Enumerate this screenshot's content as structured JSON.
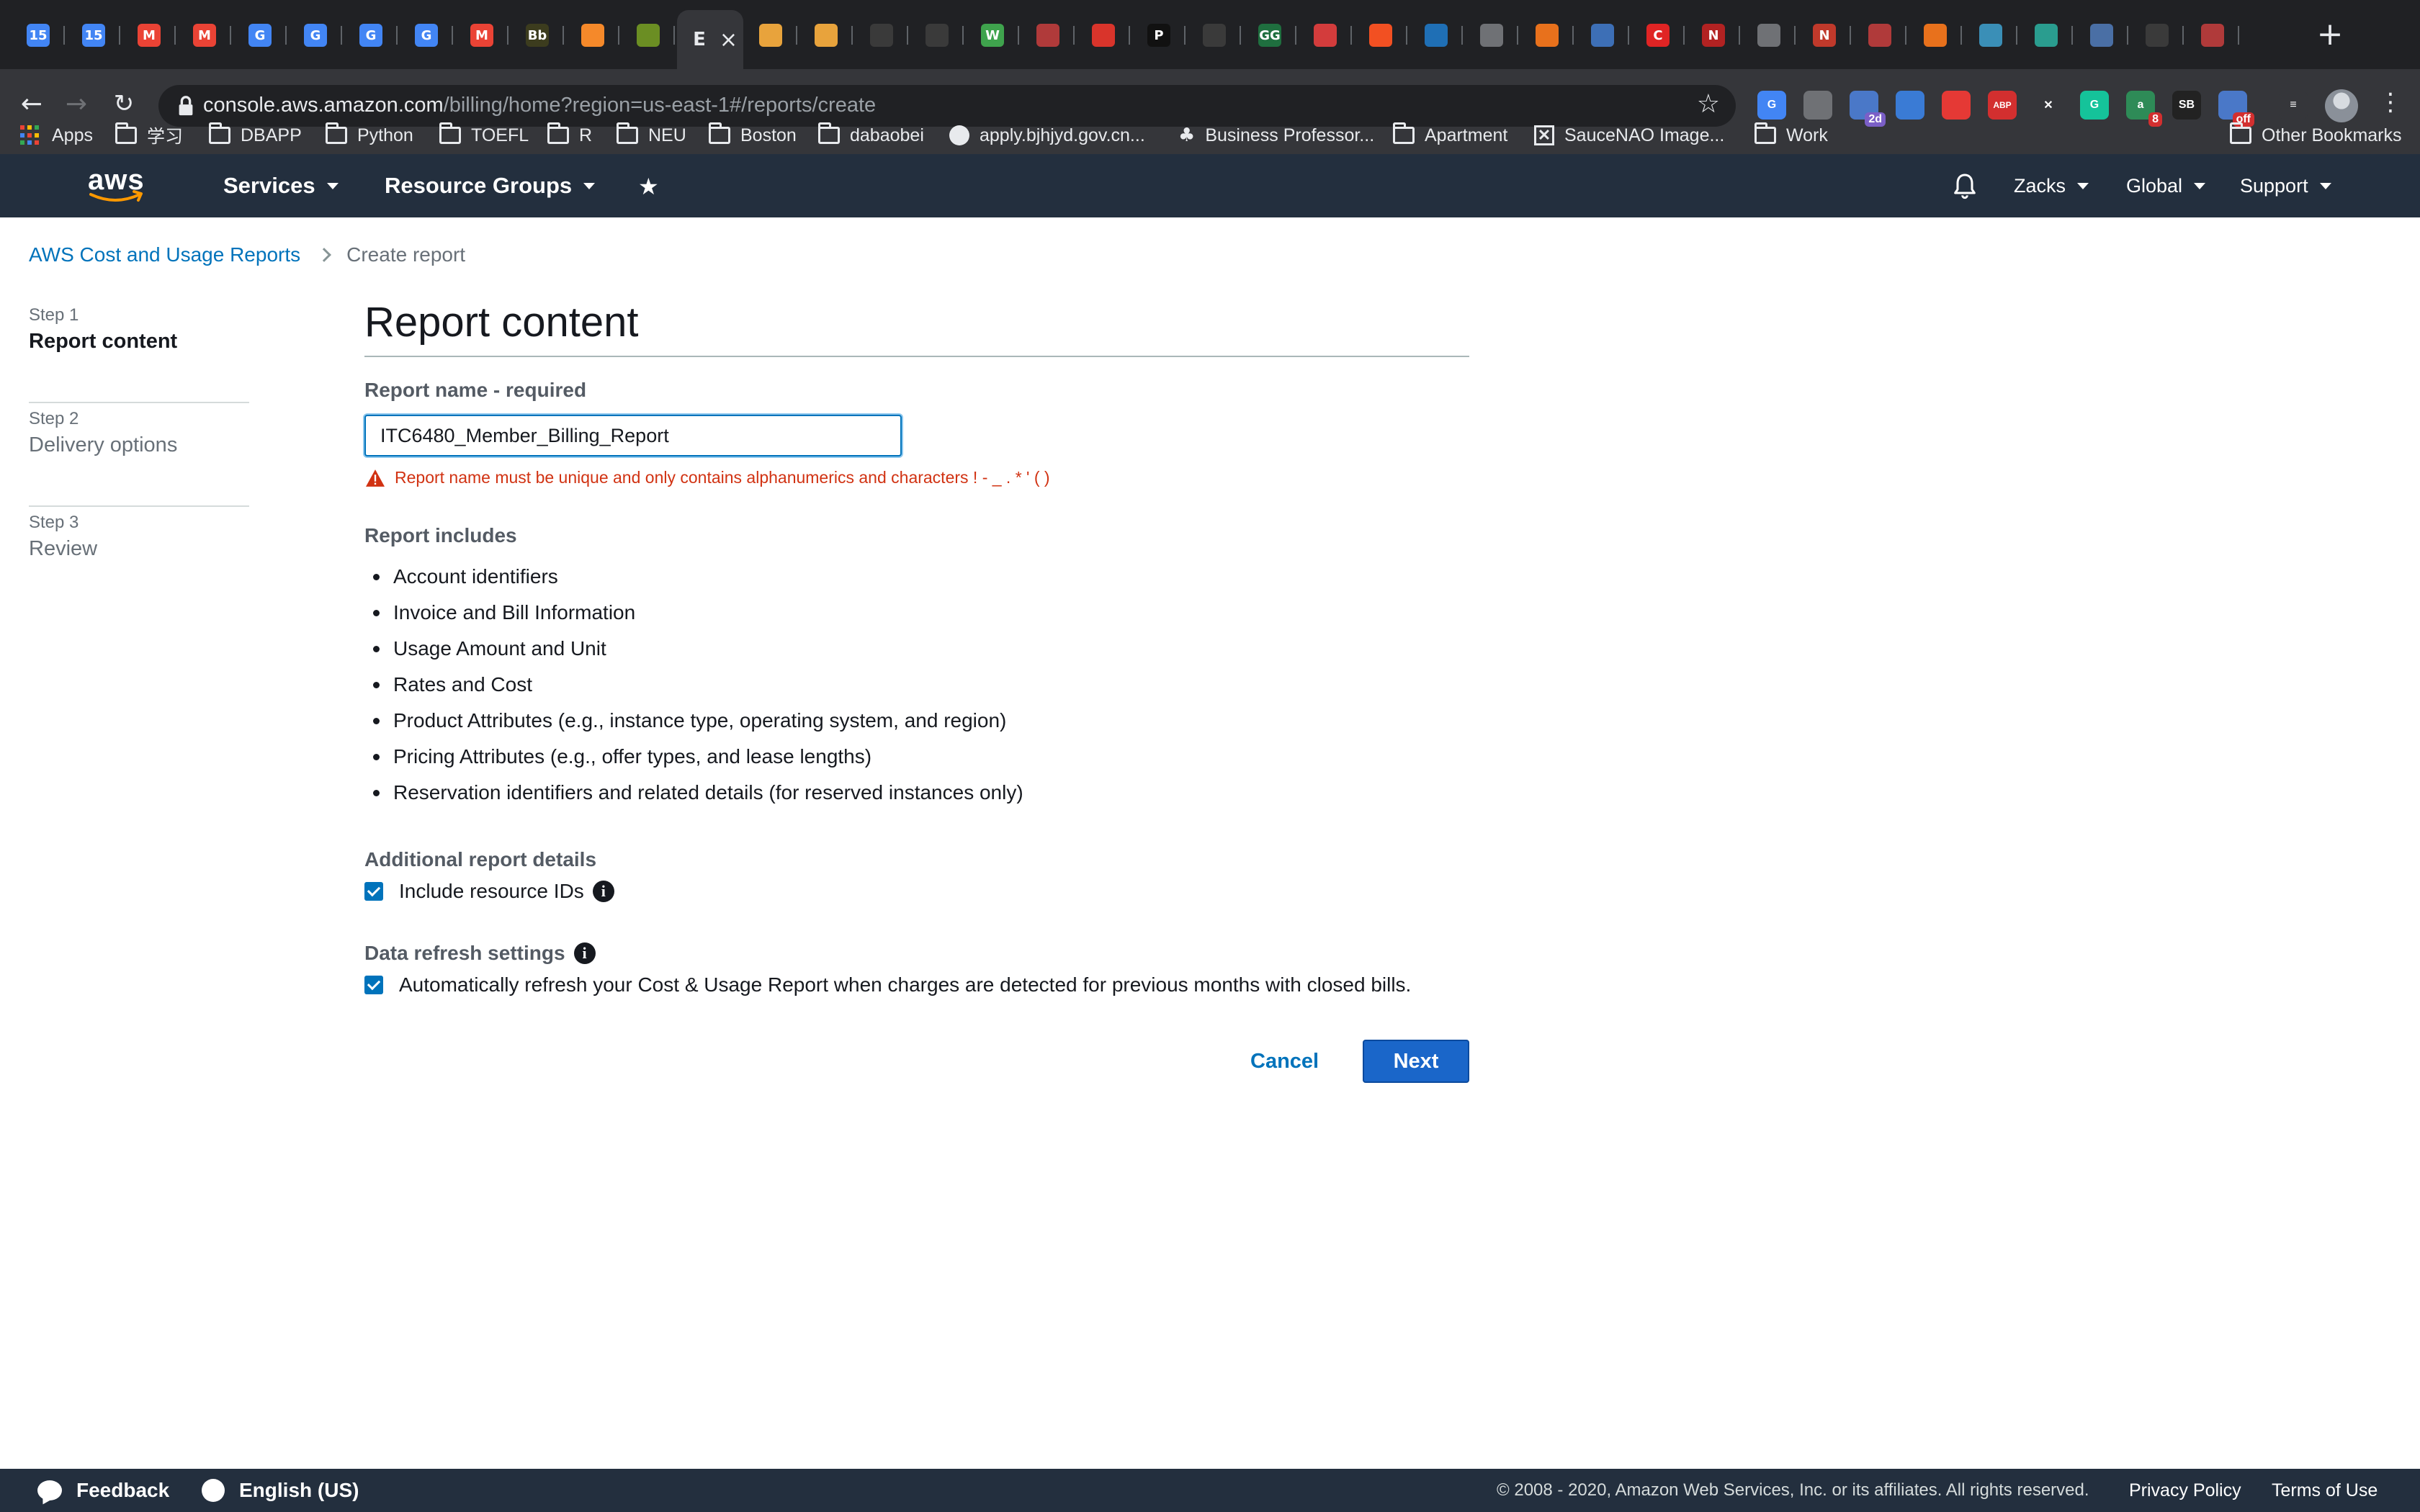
{
  "browser": {
    "tabs": [
      {
        "icon": "calendar-icon",
        "text": "15",
        "color": "#4285f4"
      },
      {
        "icon": "calendar-icon",
        "text": "15",
        "color": "#4285f4"
      },
      {
        "icon": "gmail-icon",
        "text": "M",
        "color": "#ea4335"
      },
      {
        "icon": "gmail-icon",
        "text": "M",
        "color": "#ea4335"
      },
      {
        "icon": "translate-icon",
        "text": "G",
        "color": "#4285f4"
      },
      {
        "icon": "translate-icon",
        "text": "G",
        "color": "#4285f4"
      },
      {
        "icon": "translate-icon",
        "text": "G",
        "color": "#4285f4"
      },
      {
        "icon": "translate-icon",
        "text": "G",
        "color": "#4285f4"
      },
      {
        "icon": "gmail-icon",
        "text": "M",
        "color": "#ea4335"
      },
      {
        "icon": "blackboard-icon",
        "text": "Bb",
        "color": "#3c3c1e"
      },
      {
        "icon": "box-icon",
        "text": "",
        "color": "#f5892a"
      },
      {
        "icon": "key-icon",
        "text": "",
        "color": "#6b8e23"
      },
      {
        "icon": "aws-tab-icon",
        "text": "E",
        "color": "#35363a",
        "active": true
      },
      {
        "icon": "package-icon",
        "text": "",
        "color": "#e8a33c"
      },
      {
        "icon": "package-icon",
        "text": "",
        "color": "#e8a33c"
      },
      {
        "icon": "graduation-cap-icon",
        "text": "",
        "color": "#3a3a3a"
      },
      {
        "icon": "graduation-cap-icon",
        "text": "",
        "color": "#3a3a3a"
      },
      {
        "icon": "w-icon",
        "text": "W",
        "color": "#3fa34d"
      },
      {
        "icon": "crest-icon",
        "text": "",
        "color": "#b03a3a"
      },
      {
        "icon": "layers-icon",
        "text": "",
        "color": "#d9342b"
      },
      {
        "icon": "p-icon",
        "text": "P",
        "color": "#111111"
      },
      {
        "icon": "loading-icon",
        "text": "",
        "color": "#3a3a3a"
      },
      {
        "icon": "gg-icon",
        "text": "GG",
        "color": "#1f6f3f"
      },
      {
        "icon": "flag-icon",
        "text": "",
        "color": "#d33c3c"
      },
      {
        "icon": "microsoft-icon",
        "text": "",
        "color": "#f25022"
      },
      {
        "icon": "cloud-icon",
        "text": "",
        "color": "#1f6fb5"
      },
      {
        "icon": "globe-icon",
        "text": "",
        "color": "#6f7175"
      },
      {
        "icon": "ring-icon",
        "text": "",
        "color": "#e8711c"
      },
      {
        "icon": "swirl-icon",
        "text": "",
        "color": "#3d6fb6"
      },
      {
        "icon": "c-icon",
        "text": "C",
        "color": "#e02424"
      },
      {
        "icon": "n-slash-icon",
        "text": "N",
        "color": "#b22222"
      },
      {
        "icon": "globe-icon",
        "text": "",
        "color": "#6f7175"
      },
      {
        "icon": "n-icon",
        "text": "N",
        "color": "#c0392b"
      },
      {
        "icon": "crest-icon",
        "text": "",
        "color": "#b03a3a"
      },
      {
        "icon": "ring-icon",
        "text": "",
        "color": "#e8711c"
      },
      {
        "icon": "chart-icon",
        "text": "",
        "color": "#3a8fb7"
      },
      {
        "icon": "check-chart-icon",
        "text": "",
        "color": "#2a9d8f"
      },
      {
        "icon": "castle-icon",
        "text": "",
        "color": "#4a6fa5"
      },
      {
        "icon": "graduation-cap-icon",
        "text": "",
        "color": "#3a3a3a"
      },
      {
        "icon": "crest-icon",
        "text": "",
        "color": "#b03a3a"
      }
    ],
    "url_host": "console.aws.amazon.com",
    "url_path": "/billing/home?region=us-east-1#/reports/create",
    "extensions": [
      {
        "icon": "translate-ext-icon",
        "text": "G",
        "color": "#4285f4"
      },
      {
        "icon": "bulb-ext-icon",
        "text": "",
        "color": "#6f7175"
      },
      {
        "icon": "calendar-ext-icon",
        "text": "",
        "color": "#4a78c8",
        "badge": "2d",
        "badge_color": "#7b5fc7"
      },
      {
        "icon": "doc-ext-icon",
        "text": "",
        "color": "#3a7bd5"
      },
      {
        "icon": "stop-ext-icon",
        "text": "",
        "color": "#e53935"
      },
      {
        "icon": "abp-ext-icon",
        "text": "ABP",
        "color": "#d32f2f"
      },
      {
        "icon": "x-ext-icon",
        "text": "✕",
        "color": "#35363a"
      },
      {
        "icon": "grammarly-ext-icon",
        "text": "G",
        "color": "#15c39a"
      },
      {
        "icon": "a-ext-icon",
        "text": "a",
        "color": "#2e8b57",
        "badge": "8",
        "badge_color": "#d32f2f"
      },
      {
        "icon": "sb-ext-icon",
        "text": "SB",
        "color": "#222222"
      },
      {
        "icon": "calendar-off-ext-icon",
        "text": "",
        "color": "#4a78c8",
        "badge": "off",
        "badge_color": "#d32f2f"
      },
      {
        "icon": "media-ext-icon",
        "text": "≡",
        "color": "#35363a"
      }
    ]
  },
  "bookmarks": [
    {
      "label": "Apps",
      "type": "apps"
    },
    {
      "label": "学习",
      "type": "folder"
    },
    {
      "label": "DBAPP",
      "type": "folder"
    },
    {
      "label": "Python",
      "type": "folder"
    },
    {
      "label": "TOEFL",
      "type": "folder"
    },
    {
      "label": "R",
      "type": "folder"
    },
    {
      "label": "NEU",
      "type": "folder"
    },
    {
      "label": "Boston",
      "type": "folder"
    },
    {
      "label": "dabaobei",
      "type": "folder"
    },
    {
      "label": "apply.bjhjyd.gov.cn...",
      "type": "globe"
    },
    {
      "label": "Business Professor...",
      "type": "tree"
    },
    {
      "label": "Apartment",
      "type": "folder"
    },
    {
      "label": "SauceNAO Image...",
      "type": "x"
    },
    {
      "label": "Work",
      "type": "folder"
    },
    {
      "label": "Other Bookmarks",
      "type": "folder"
    }
  ],
  "aws_header": {
    "logo": "aws",
    "services": "Services",
    "resource_groups": "Resource Groups",
    "account": "Zacks",
    "region": "Global",
    "support": "Support"
  },
  "breadcrumb": {
    "parent": "AWS Cost and Usage Reports",
    "current": "Create report"
  },
  "steps": [
    {
      "num": "Step 1",
      "title": "Report content"
    },
    {
      "num": "Step 2",
      "title": "Delivery options"
    },
    {
      "num": "Step 3",
      "title": "Review"
    }
  ],
  "form": {
    "title": "Report content",
    "name_label": "Report name - required",
    "name_value": "ITC6480_Member_Billing_Report",
    "error": "Report name must be unique and only contains alphanumerics and characters ! - _ . * ' ( )",
    "includes_label": "Report includes",
    "includes": [
      "Account identifiers",
      "Invoice and Bill Information",
      "Usage Amount and Unit",
      "Rates and Cost",
      "Product Attributes (e.g., instance type, operating system, and region)",
      "Pricing Attributes (e.g., offer types, and lease lengths)",
      "Reservation identifiers and related details (for reserved instances only)"
    ],
    "additional_label": "Additional report details",
    "include_resource_ids": "Include resource IDs",
    "refresh_label": "Data refresh settings",
    "auto_refresh": "Automatically refresh your Cost & Usage Report when charges are detected for previous months with closed bills.",
    "cancel": "Cancel",
    "next": "Next"
  },
  "footer": {
    "feedback": "Feedback",
    "language": "English (US)",
    "copyright": "© 2008 - 2020, Amazon Web Services, Inc. or its affiliates. All rights reserved.",
    "privacy": "Privacy Policy",
    "terms": "Terms of Use"
  },
  "colors": {
    "aws_nav": "#232f3e",
    "link": "#0073bb",
    "error": "#d13212",
    "primary_button": "#1a66c9",
    "aws_orange": "#ff9900"
  }
}
